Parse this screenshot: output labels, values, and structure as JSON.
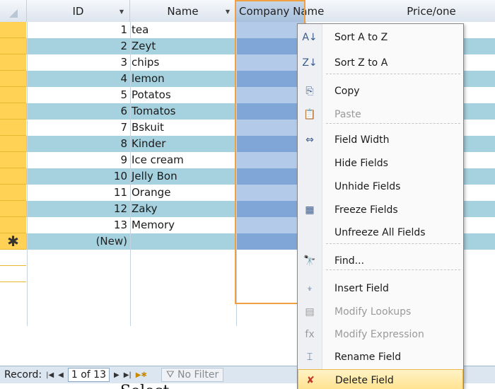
{
  "table": {
    "columns": [
      {
        "label": "ID"
      },
      {
        "label": "Name"
      },
      {
        "label": "Company Name"
      },
      {
        "label": "Price/one"
      }
    ],
    "rows": [
      {
        "id": "1",
        "name": "tea"
      },
      {
        "id": "2",
        "name": "Zeyt"
      },
      {
        "id": "3",
        "name": "chips"
      },
      {
        "id": "4",
        "name": "lemon"
      },
      {
        "id": "5",
        "name": "Potatos"
      },
      {
        "id": "6",
        "name": "Tomatos"
      },
      {
        "id": "7",
        "name": "Bskuit"
      },
      {
        "id": "8",
        "name": "Kinder"
      },
      {
        "id": "9",
        "name": "Ice cream"
      },
      {
        "id": "10",
        "name": "Jelly Bon"
      },
      {
        "id": "11",
        "name": "Orange"
      },
      {
        "id": "12",
        "name": "Zaky"
      },
      {
        "id": "13",
        "name": "Memory"
      }
    ],
    "new_row": {
      "marker": "✱",
      "label": "(New)"
    }
  },
  "menu": {
    "items": [
      {
        "label": "Sort A to Z",
        "icon": "sort-az-icon",
        "glyph": "A↓"
      },
      {
        "label": "Sort Z to A",
        "icon": "sort-za-icon",
        "glyph": "Z↓"
      },
      {
        "label": "Copy",
        "icon": "copy-icon",
        "glyph": "⎘"
      },
      {
        "label": "Paste",
        "icon": "paste-icon",
        "glyph": "📋"
      },
      {
        "label": "Field Width",
        "icon": "field-width-icon",
        "glyph": "⇔"
      },
      {
        "label": "Hide Fields",
        "icon": "",
        "glyph": ""
      },
      {
        "label": "Unhide Fields",
        "icon": "",
        "glyph": ""
      },
      {
        "label": "Freeze Fields",
        "icon": "freeze-fields-icon",
        "glyph": "▦"
      },
      {
        "label": "Unfreeze All Fields",
        "icon": "",
        "glyph": ""
      },
      {
        "label": "Find...",
        "icon": "find-icon",
        "glyph": "🔭"
      },
      {
        "label": "Insert Field",
        "icon": "insert-field-icon",
        "glyph": "⍖"
      },
      {
        "label": "Modify Lookups",
        "icon": "modify-lookups-icon",
        "glyph": "▤"
      },
      {
        "label": "Modify Expression",
        "icon": "function-icon",
        "glyph": "fx"
      },
      {
        "label": "Rename Field",
        "icon": "rename-field-icon",
        "glyph": "⌶"
      },
      {
        "label": "Delete Field",
        "icon": "delete-field-icon",
        "glyph": "✘"
      }
    ]
  },
  "recordbar": {
    "label": "Record:",
    "first": "|◀",
    "prev": "◀",
    "position": "1 of 13",
    "next": "▶",
    "last": "▶|",
    "new": "▶✱",
    "filter_icon": "filter-icon",
    "filter": "No Filter"
  },
  "caption": "Select",
  "colors": {
    "accent": "#f0a040",
    "rowband": "#a6d1df",
    "selector": "#ffd255",
    "hover": "#ffe18a"
  }
}
